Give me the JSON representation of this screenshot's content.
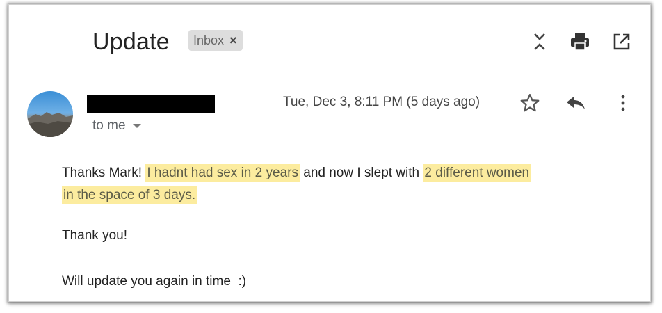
{
  "email": {
    "subject": "Update",
    "label": "Inbox",
    "label_close": "×",
    "recipient": "to me",
    "date": "Tue, Dec 3, 8:11 PM (5 days ago)",
    "body": {
      "p1_intro": "Thanks Mark!",
      "p1_highlight1": "I hadnt had sex in 2 years",
      "p1_middle": "and now I slept with",
      "p1_highlight2a": "2 different women",
      "p1_highlight2b": "in the space of 3 days.",
      "p2": "Thank you!",
      "p3": "Will update you again in time  :)"
    }
  },
  "icons": {
    "collapse": "collapse-all-icon",
    "print": "print-icon",
    "open_new_window": "open-in-new-window-icon",
    "star": "star-icon",
    "reply": "reply-icon",
    "more": "more-vert-icon",
    "caret": "chevron-down-icon"
  },
  "colors": {
    "highlight": "#fcec9f",
    "text": "#222222",
    "secondary_text": "#5f6368",
    "chip_bg": "#dddddd"
  }
}
